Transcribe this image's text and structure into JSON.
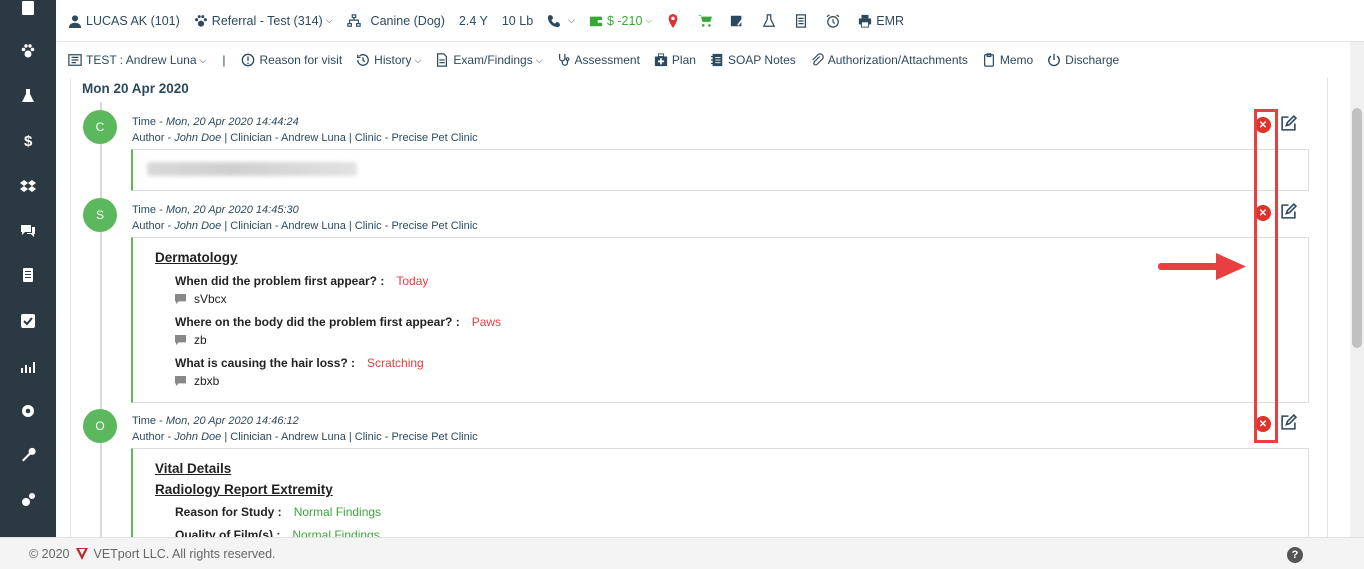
{
  "header": {
    "patient": "LUCAS AK (101)",
    "referral": "Referral - Test (314)",
    "species": "Canine (Dog)",
    "age": "2.4 Y",
    "weight": "10 Lb",
    "balance": "$ -210",
    "emr": "EMR"
  },
  "toolbar": {
    "test_label": "TEST : Andrew Luna",
    "separator": "|",
    "reason": "Reason for visit",
    "history": "History",
    "exam": "Exam/Findings",
    "assessment": "Assessment",
    "plan": "Plan",
    "soap": "SOAP Notes",
    "auth": "Authorization/Attachments",
    "memo": "Memo",
    "discharge": "Discharge"
  },
  "date_heading": "Mon 20 Apr 2020",
  "entries": [
    {
      "letter": "C",
      "time_prefix": "Time - ",
      "time": "Mon, 20 Apr 2020 14:44:24",
      "author_prefix": "Author - ",
      "author": "John Doe",
      "clinician": " | Clinician - Andrew Luna |  Clinic - Precise Pet Clinic"
    },
    {
      "letter": "S",
      "time_prefix": "Time - ",
      "time": "Mon, 20 Apr 2020 14:45:30",
      "author_prefix": "Author - ",
      "author": "John Doe",
      "clinician": " | Clinician - Andrew Luna |  Clinic - Precise Pet Clinic",
      "section": "Dermatology",
      "questions": [
        {
          "q": "When did the problem first appear? :",
          "a": "Today",
          "note": "sVbcx"
        },
        {
          "q": "Where on the body did the problem first appear? :",
          "a": "Paws",
          "note": "zb"
        },
        {
          "q": "What is causing the hair loss? :",
          "a": "Scratching",
          "note": "zbxb"
        }
      ]
    },
    {
      "letter": "O",
      "time_prefix": "Time - ",
      "time": "Mon, 20 Apr 2020 14:46:12",
      "author_prefix": "Author - ",
      "author": "John Doe",
      "clinician": " | Clinician - Andrew Luna |  Clinic - Precise Pet Clinic",
      "section1": "Vital Details",
      "section2": "Radiology Report Extremity",
      "questions": [
        {
          "q": "Reason for Study :",
          "a": "Normal Findings"
        },
        {
          "q": "Quality of Film(s) :",
          "a": "Normal Findings"
        }
      ]
    }
  ],
  "footer": {
    "copyright": "© 2020",
    "company": "VETport LLC. All rights reserved."
  },
  "colors": {
    "accent": "#2c4a5e",
    "success": "#5cb85c",
    "danger": "#e0322b",
    "sidebar": "#2b3a42"
  }
}
